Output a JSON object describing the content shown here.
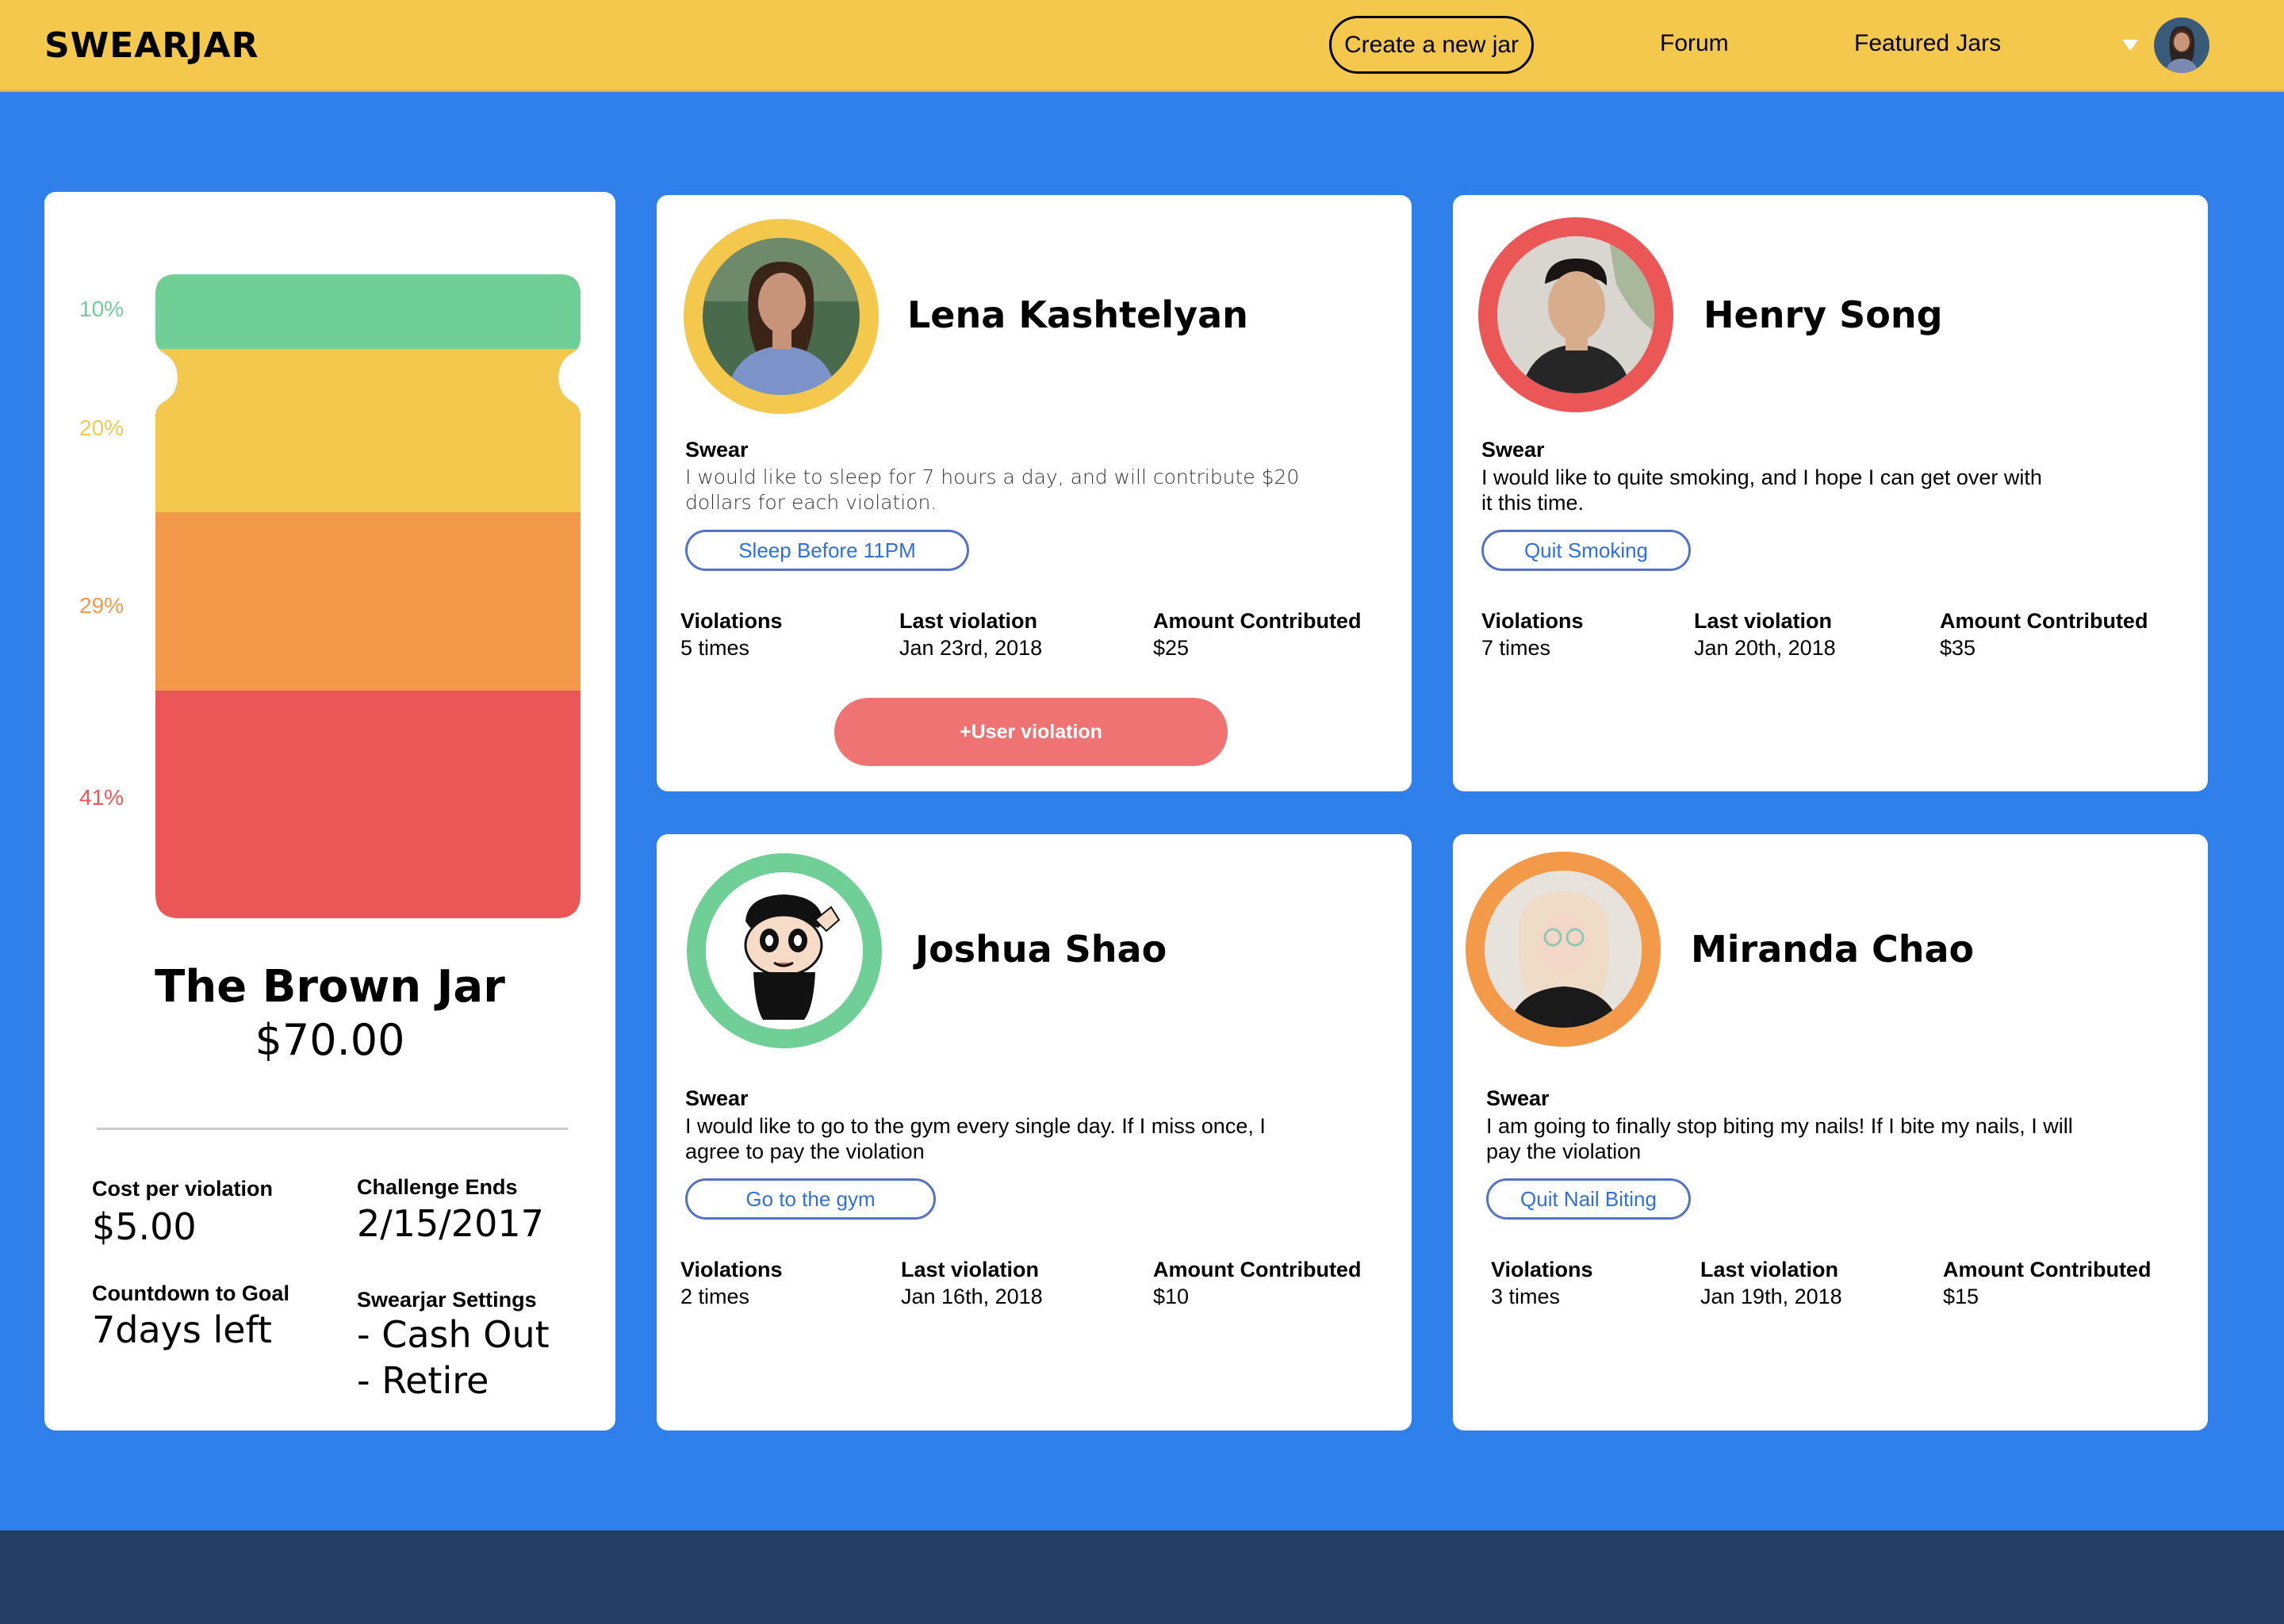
{
  "app": {
    "title": "SWEARJAR"
  },
  "nav": {
    "create_label": "Create a new jar",
    "forum_label": "Forum",
    "featured_label": "Featured Jars"
  },
  "colors": {
    "header": "#F3C84D",
    "background": "#3080EB",
    "footer": "#253C63",
    "green": "#6FCF97",
    "yellow": "#F3C84D",
    "orange": "#F2994A",
    "red": "#EB5757"
  },
  "jar": {
    "segments": [
      {
        "label": "10%",
        "color": "#6FCF97"
      },
      {
        "label": "20%",
        "color": "#F3C84D"
      },
      {
        "label": "29%",
        "color": "#F2994A"
      },
      {
        "label": "41%",
        "color": "#EB5757"
      }
    ],
    "name": "The Brown Jar",
    "amount": "$70.00",
    "cost_label": "Cost per violation",
    "cost_value": "$5.00",
    "challenge_label": "Challenge Ends",
    "challenge_value": "2/15/2017",
    "countdown_label": "Countdown to Goal",
    "countdown_value": "7days left",
    "settings_label": "Swearjar Settings",
    "settings_cashout": "- Cash Out",
    "settings_retire": "- Retire"
  },
  "members": [
    {
      "name": "Lena  Kashtelyan",
      "ring_color": "#F3C84D",
      "swear_label": "Swear",
      "swear_line1": "I would  like to sleep for 7 hours a day,  and will contribute $20",
      "swear_line2": "dollars for each violation.",
      "tag": "Sleep  Before 11PM",
      "violations_label": "Violations",
      "violations_value": "5 times",
      "last_label": "Last violation",
      "last_value": "Jan 23rd, 2018",
      "amount_label": "Amount Contributed",
      "amount_value": "$25",
      "action_label": "+User violation"
    },
    {
      "name": "Henry Song",
      "ring_color": "#EB5757",
      "swear_label": "Swear",
      "swear_line1": "I would like to quite smoking, and I hope I can get over with",
      "swear_line2": "it this time.",
      "tag": "Quit Smoking",
      "violations_label": "Violations",
      "violations_value": "7 times",
      "last_label": "Last violation",
      "last_value": "Jan 20th, 2018",
      "amount_label": "Amount Contributed",
      "amount_value": "$35"
    },
    {
      "name": "Joshua Shao",
      "ring_color": "#6FCF97",
      "swear_label": "Swear",
      "swear_line1": "I  would like to go to the gym every single day. If I miss once, I",
      "swear_line2": "agree to pay the violation",
      "tag": "Go to the gym",
      "violations_label": "Violations",
      "violations_value": "2 times",
      "last_label": "Last violation",
      "last_value": "Jan 16th, 2018",
      "amount_label": "Amount Contributed",
      "amount_value": "$10"
    },
    {
      "name": "Miranda Chao",
      "ring_color": "#F2994A",
      "swear_label": "Swear",
      "swear_line1": "I  am going to finally stop biting my nails! If I bite my nails, I will",
      "swear_line2": "pay the violation",
      "tag": "Quit Nail Biting",
      "violations_label": "Violations",
      "violations_value": "3 times",
      "last_label": "Last violation",
      "last_value": "Jan 19th, 2018",
      "amount_label": "Amount Contributed",
      "amount_value": "$15"
    }
  ]
}
